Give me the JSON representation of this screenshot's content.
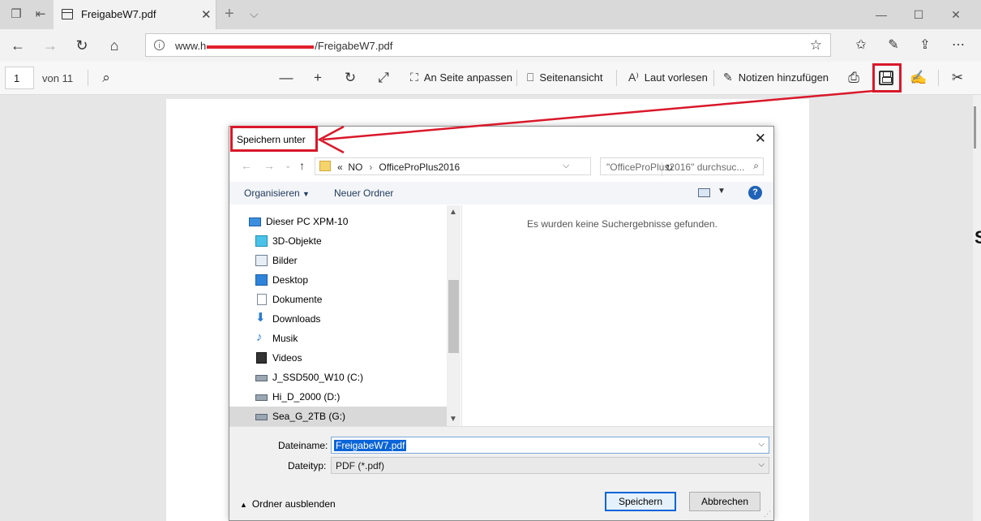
{
  "browser": {
    "tab_title": "FreigabeW7.pdf",
    "url_prefix": "www.h",
    "url_suffix": "/FreigabeW7.pdf",
    "icons": {
      "tab_set_aside": "tabs-icon",
      "tab_back": "set-aside-icon",
      "new_tab": "plus-icon",
      "tab_list": "chevron-down-icon",
      "back": "arrow-left-icon",
      "forward": "arrow-right-icon",
      "refresh": "refresh-icon",
      "home": "home-icon",
      "favorite": "star-icon",
      "favorites_bar": "favorites-icon",
      "notes": "pen-icon",
      "share": "share-icon",
      "more": "more-icon"
    }
  },
  "pdf_toolbar": {
    "page_number": "1",
    "page_count": "von 11",
    "fit_page": "An Seite anpassen",
    "page_view": "Seitenansicht",
    "read_aloud": "Laut vorlesen",
    "add_notes": "Notizen hinzufügen"
  },
  "dialog": {
    "title": "Speichern unter",
    "path_prefix": "«",
    "path_segments": [
      "NO",
      "OfficeProPlus2016"
    ],
    "search_placeholder": "\"OfficeProPlus2016\" durchsuc...",
    "organize": "Organisieren",
    "new_folder": "Neuer Ordner",
    "help": "?",
    "tree": [
      {
        "label": "Dieser PC XPM-10",
        "icon": "pc-icon"
      },
      {
        "label": "3D-Objekte",
        "icon": "3d-objects-icon"
      },
      {
        "label": "Bilder",
        "icon": "pictures-icon"
      },
      {
        "label": "Desktop",
        "icon": "desktop-icon"
      },
      {
        "label": "Dokumente",
        "icon": "documents-icon"
      },
      {
        "label": "Downloads",
        "icon": "downloads-icon"
      },
      {
        "label": "Musik",
        "icon": "music-icon"
      },
      {
        "label": "Videos",
        "icon": "videos-icon"
      },
      {
        "label": "J_SSD500_W10 (C:)",
        "icon": "drive-icon"
      },
      {
        "label": "Hi_D_2000 (D:)",
        "icon": "drive-icon"
      },
      {
        "label": "Sea_G_2TB (G:)",
        "icon": "drive-icon"
      }
    ],
    "no_results": "Es wurden keine Suchergebnisse gefunden.",
    "filename_label": "Dateiname:",
    "filename_value": "FreigabeW7.pdf",
    "filetype_label": "Dateityp:",
    "filetype_value": "PDF (*.pdf)",
    "hide_folders": "Ordner ausblenden",
    "save_button": "Speichern",
    "cancel_button": "Abbrechen"
  },
  "colors": {
    "annotation": "#d9182a",
    "selection": "#0a64d8",
    "help": "#1f62b7"
  }
}
